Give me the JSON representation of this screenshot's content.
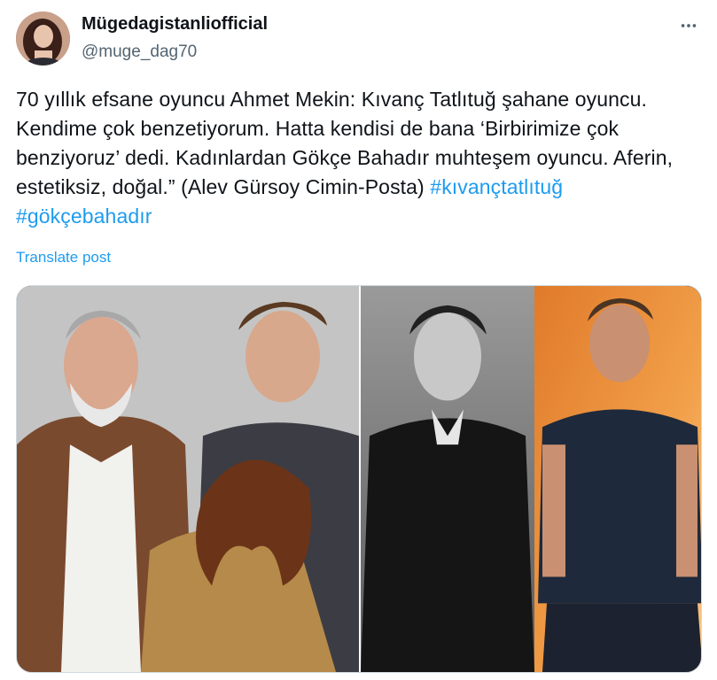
{
  "user": {
    "display_name": "Mügedagistanliofficial",
    "handle": "@muge_dag70"
  },
  "tweet": {
    "text": "70 yıllık efsane oyuncu Ahmet Mekin: Kıvanç Tatlıtuğ şahane oyuncu. Kendime çok benzetiyorum. Hatta kendisi de bana ‘Birbirimize çok benziyoruz’ dedi. Kadınlardan Gökçe Bahadır muhteşem oyuncu. Aferin, estetiksiz, doğal.” (Alev Gürsoy Cimin-Posta) ",
    "hashtags": [
      "#kıvançtatlıtuğ",
      "#gökçebahadır"
    ],
    "translate_label": "Translate post"
  },
  "icons": {
    "more": "more-horizontal-icon"
  },
  "colors": {
    "link": "#1d9bf0",
    "text": "#0f1419",
    "secondary": "#536471"
  }
}
